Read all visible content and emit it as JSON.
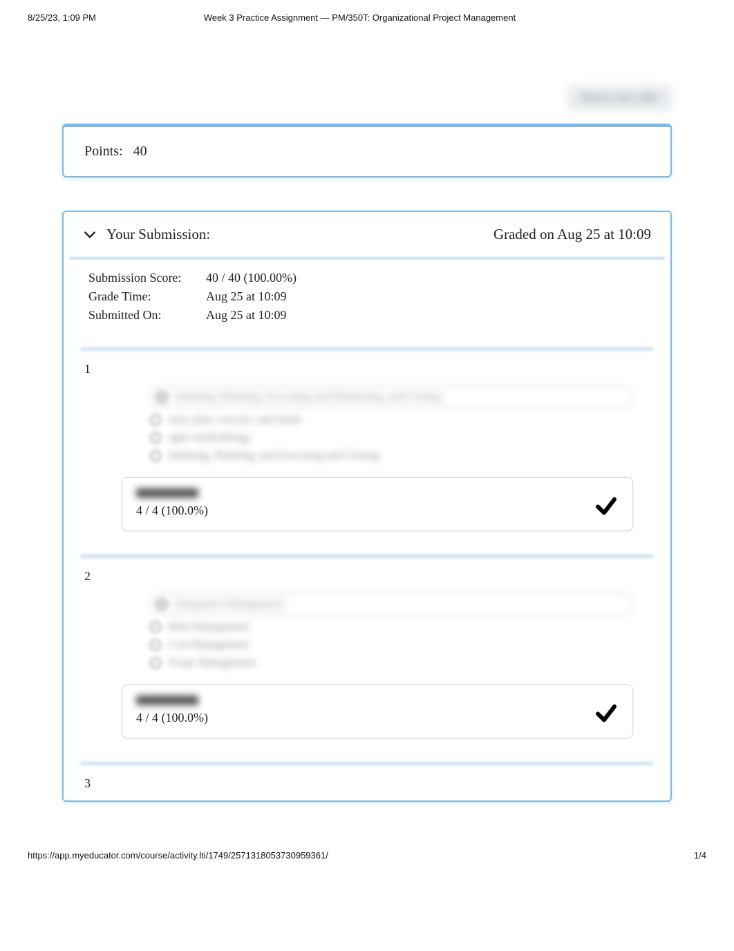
{
  "print_header": {
    "left": "8/25/23, 1:09 PM",
    "center": "Week 3 Practice Assignment — PM/350T: Organizational Project Management"
  },
  "top_button_label": "Back to my LMS",
  "points": {
    "label": "Points:",
    "value": "40"
  },
  "submission": {
    "chevron": "expanded",
    "title": "Your Submission:",
    "graded_on": "Graded on Aug 25 at 10:09",
    "meta": {
      "score_label": "Submission Score:",
      "score_value": "40 / 40 (100.00%)",
      "grade_time_label": "Grade Time:",
      "grade_time_value": "Aug 25 at 10:09",
      "submitted_label": "Submitted On:",
      "submitted_value": "Aug 25 at 10:09"
    }
  },
  "questions": [
    {
      "number": "1",
      "options": [
        "Initiating, Planning, Executing and Monitoring, and Closing",
        "start, plan, execute, and finish",
        "agile methodology",
        "Initiating, Planning, and Executing and Closing"
      ],
      "feedback_label": "Feedback",
      "score": "4 / 4 (100.0%)",
      "correct": true
    },
    {
      "number": "2",
      "options": [
        "Integration Management",
        "Risk Management",
        "Cost Management",
        "Scope Management"
      ],
      "feedback_label": "Feedback",
      "score": "4 / 4 (100.0%)",
      "correct": true
    },
    {
      "number": "3"
    }
  ],
  "print_footer": {
    "url": "https://app.myeducator.com/course/activity.lti/1749/2571318053730959361/",
    "page": "1/4"
  }
}
